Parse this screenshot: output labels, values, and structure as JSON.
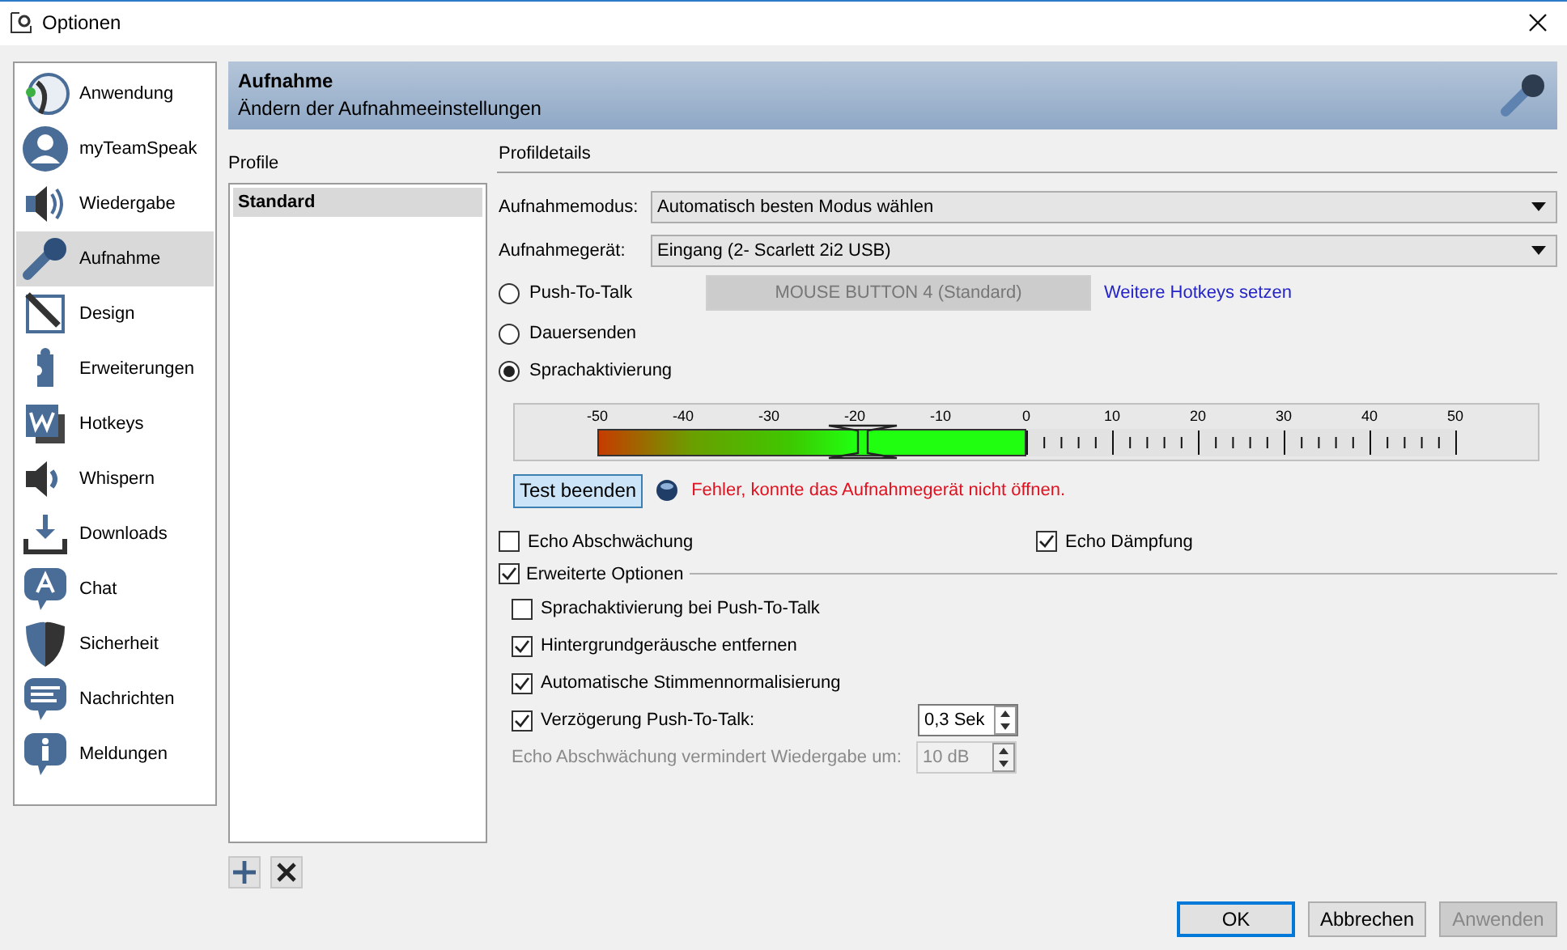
{
  "window": {
    "title": "Optionen"
  },
  "sidebar": {
    "items": [
      {
        "label": "Anwendung",
        "selected": false
      },
      {
        "label": "myTeamSpeak",
        "selected": false
      },
      {
        "label": "Wiedergabe",
        "selected": false
      },
      {
        "label": "Aufnahme",
        "selected": true
      },
      {
        "label": "Design",
        "selected": false
      },
      {
        "label": "Erweiterungen",
        "selected": false
      },
      {
        "label": "Hotkeys",
        "selected": false
      },
      {
        "label": "Whispern",
        "selected": false
      },
      {
        "label": "Downloads",
        "selected": false
      },
      {
        "label": "Chat",
        "selected": false
      },
      {
        "label": "Sicherheit",
        "selected": false
      },
      {
        "label": "Nachrichten",
        "selected": false
      },
      {
        "label": "Meldungen",
        "selected": false
      }
    ]
  },
  "header": {
    "title": "Aufnahme",
    "subtitle": "Ändern der Aufnahmeeinstellungen"
  },
  "profiles": {
    "label": "Profile",
    "items": [
      {
        "label": "Standard",
        "selected": true
      }
    ]
  },
  "details": {
    "label": "Profildetails",
    "mode": {
      "label": "Aufnahmemodus:",
      "value": "Automatisch besten Modus wählen"
    },
    "device": {
      "label": "Aufnahmegerät:",
      "value": "Eingang (2- Scarlett 2i2 USB)"
    },
    "transmit": [
      {
        "label": "Push-To-Talk",
        "selected": false,
        "hotkey": {
          "label": "MOUSE BUTTON 4 (Standard)",
          "disabled": true
        },
        "link": "Weitere Hotkeys setzen"
      },
      {
        "label": "Dauersenden",
        "selected": false
      },
      {
        "label": "Sprachaktivierung",
        "selected": true
      }
    ],
    "meter": {
      "ticks": [
        "-50",
        "-40",
        "-30",
        "-20",
        "-10",
        "0",
        "10",
        "20",
        "30",
        "40",
        "50"
      ],
      "level": 0.5,
      "threshold": {
        "level": 0.31
      }
    },
    "test": {
      "button": "Test beenden",
      "error": "Fehler, konnte das Aufnahmegerät nicht öffnen."
    },
    "echo": [
      {
        "label": "Echo Abschwächung",
        "checked": false
      },
      {
        "label": "Echo Dämpfung",
        "checked": true
      }
    ],
    "advanced": {
      "label": "Erweiterte Optionen",
      "checked": true,
      "options": [
        {
          "kind": "check",
          "label": "Sprachaktivierung bei Push-To-Talk",
          "checked": false
        },
        {
          "kind": "check",
          "label": "Hintergrundgeräusche entfernen",
          "checked": true
        },
        {
          "kind": "check",
          "label": "Automatische Stimmennormalisierung",
          "checked": true
        },
        {
          "kind": "checkspin",
          "label": "Verzögerung Push-To-Talk:",
          "checked": true,
          "value": "0,3 Sek",
          "disabled": false
        },
        {
          "kind": "spin",
          "label": "Echo Abschwächung vermindert Wiedergabe um:",
          "value": "10 dB",
          "disabled": true
        }
      ]
    }
  },
  "buttons": [
    {
      "label": "OK",
      "default": true,
      "disabled": false
    },
    {
      "label": "Abbrechen",
      "default": false,
      "disabled": false
    },
    {
      "label": "Anwenden",
      "default": false,
      "disabled": true
    }
  ]
}
